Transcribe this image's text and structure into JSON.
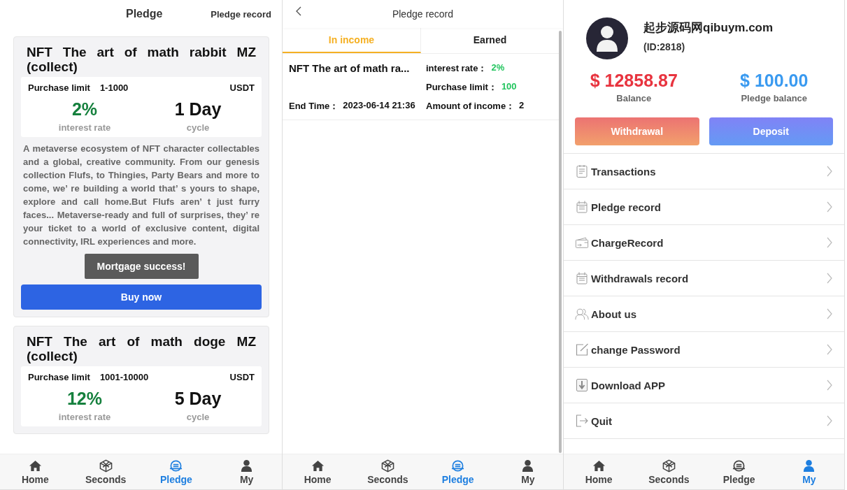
{
  "pledge_page": {
    "title": "Pledge",
    "record_link": "Pledge record",
    "products": [
      {
        "name": "NFT The art of math rabbit MZ (collect)",
        "limit_label": "Purchase limit",
        "limit": "1-1000",
        "currency": "USDT",
        "rate": "2%",
        "rate_label": "interest rate",
        "cycle": "1 Day",
        "cycle_label": "cycle",
        "description": "A metaverse ecosystem of NFT character collectables and a global, creative community. From our genesis collection Flufs, to Thingies, Party Bears and more to come, we’ re building a world that’ s yours to shape, explore and call home.But Flufs aren’ t just furry faces... Metaverse-ready and full of surprises, they’ re your ticket to a world of exclusive content, digital connectivity, IRL experiences and more.",
        "button": "Buy now"
      },
      {
        "name": "NFT The art of math doge MZ (collect)",
        "limit_label": "Purchase limit",
        "limit": "1001-10000",
        "currency": "USDT",
        "rate": "12%",
        "rate_label": "interest rate",
        "cycle": "5 Day",
        "cycle_label": "cycle"
      }
    ],
    "toast": "Mortgage success!",
    "tab_bar": [
      {
        "label": "Home",
        "selected": false
      },
      {
        "label": "Seconds",
        "selected": false
      },
      {
        "label": "Pledge",
        "selected": true
      },
      {
        "label": "My",
        "selected": false
      }
    ]
  },
  "record_page": {
    "title": "Pledge record",
    "tabs": [
      {
        "label": "In income",
        "selected": true
      },
      {
        "label": "Earned",
        "selected": false
      }
    ],
    "records": [
      {
        "name": "NFT The art of math ra...",
        "rate_label": "interest rate：",
        "rate": "2%",
        "limit_label": "Purchase limit：",
        "limit": "100",
        "end_label": "End Time：",
        "end_time": "2023-06-14 21:36",
        "income_label": "Amount of income：",
        "income": "2"
      }
    ],
    "tab_bar": [
      {
        "label": "Home",
        "selected": false
      },
      {
        "label": "Seconds",
        "selected": false
      },
      {
        "label": "Pledge",
        "selected": true
      },
      {
        "label": "My",
        "selected": false
      }
    ]
  },
  "my_page": {
    "user_name": "起步源码网qibuym.com",
    "user_id": "(ID:2818)",
    "balances": [
      {
        "amount": "$ 12858.87",
        "label": "Balance",
        "color": "#e8343f"
      },
      {
        "amount": "$ 100.00",
        "label": "Pledge balance",
        "color": "#3a9af0"
      }
    ],
    "buttons": [
      "Withdrawal",
      "Deposit"
    ],
    "menu": [
      "Transactions",
      "Pledge record",
      "ChargeRecord",
      "Withdrawals record",
      "About us",
      "change Password",
      "Download APP",
      "Quit"
    ],
    "tab_bar": [
      {
        "label": "Home",
        "selected": false
      },
      {
        "label": "Seconds",
        "selected": false
      },
      {
        "label": "Pledge",
        "selected": false
      },
      {
        "label": "My",
        "selected": true
      }
    ]
  }
}
